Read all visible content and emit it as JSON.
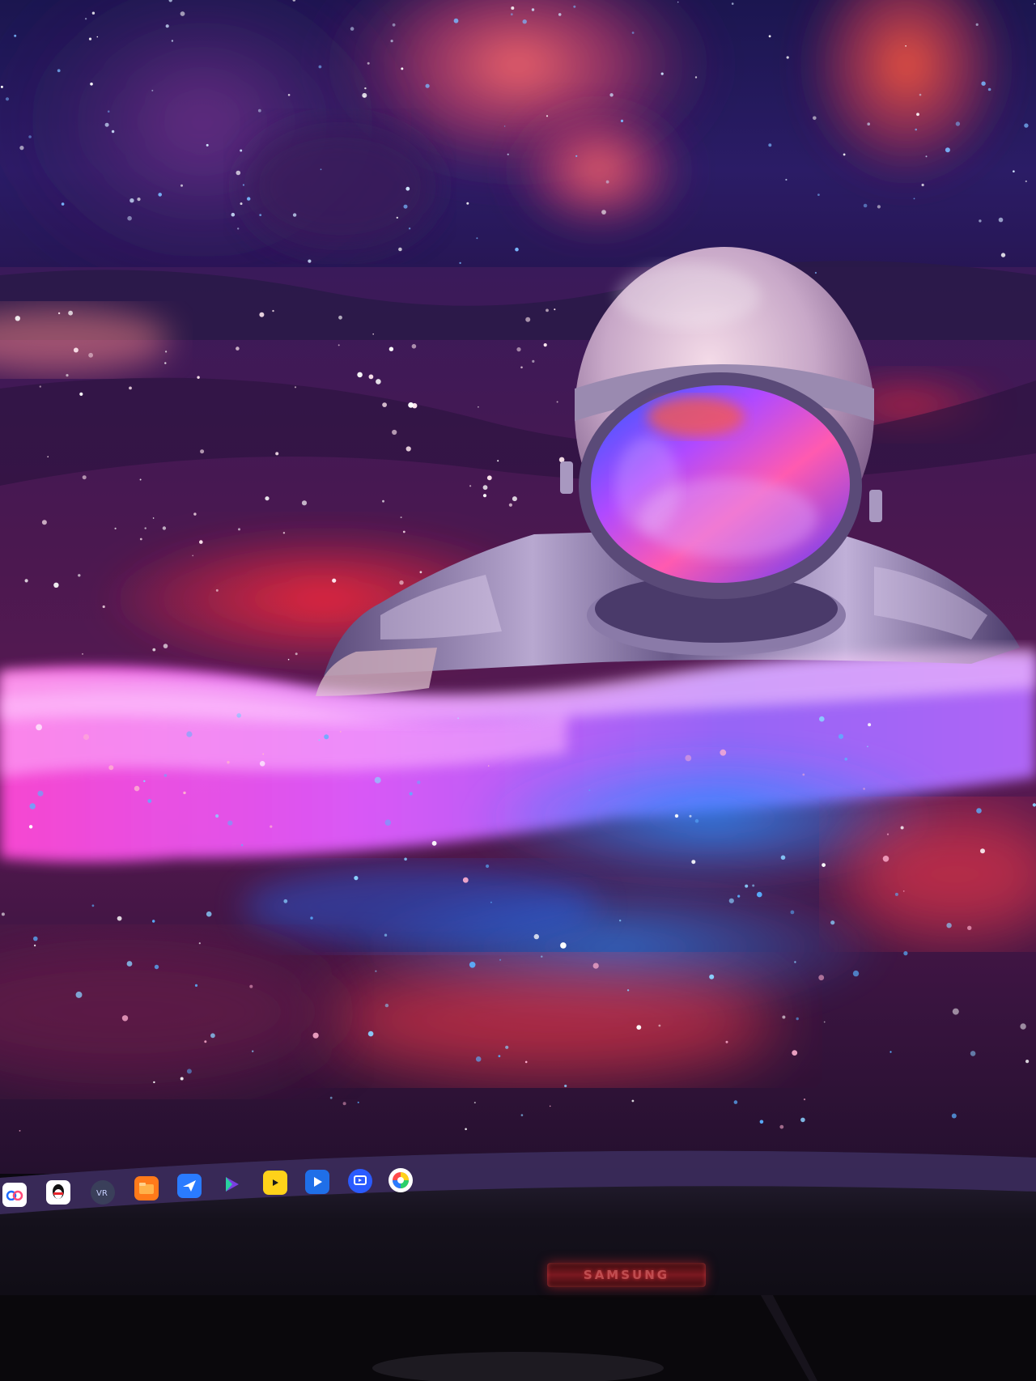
{
  "scene": {
    "description_hidden": "",
    "colors": {
      "nebula_pink": "#ff4f7a",
      "ocean_purple": "#6a2a8a",
      "glow_magenta": "#ff3cff",
      "sparkle_blue": "#2ea8ff",
      "bezel": "#14101a"
    }
  },
  "taskbar": {
    "icons": [
      {
        "name": "cloud-drive-icon",
        "bg": "#ffffff"
      },
      {
        "name": "qq-penguin-icon",
        "bg": "#ffffff"
      },
      {
        "name": "vr-app-icon",
        "bg": "#3a3f5a"
      },
      {
        "name": "orange-folder-icon",
        "bg": "#ff7a1a"
      },
      {
        "name": "blue-bird-icon",
        "bg": "#2a7bff"
      },
      {
        "name": "game-controller-icon",
        "bg": "#7a3fe0"
      },
      {
        "name": "video-player-icon",
        "bg": "#ffd21a"
      },
      {
        "name": "media-play-icon",
        "bg": "#1f6fe8"
      },
      {
        "name": "screen-share-icon",
        "bg": "#2a5bff"
      },
      {
        "name": "color-wheel-icon",
        "bg": "#ffffff"
      }
    ]
  },
  "monitor": {
    "brand": "SAMSUNG"
  }
}
